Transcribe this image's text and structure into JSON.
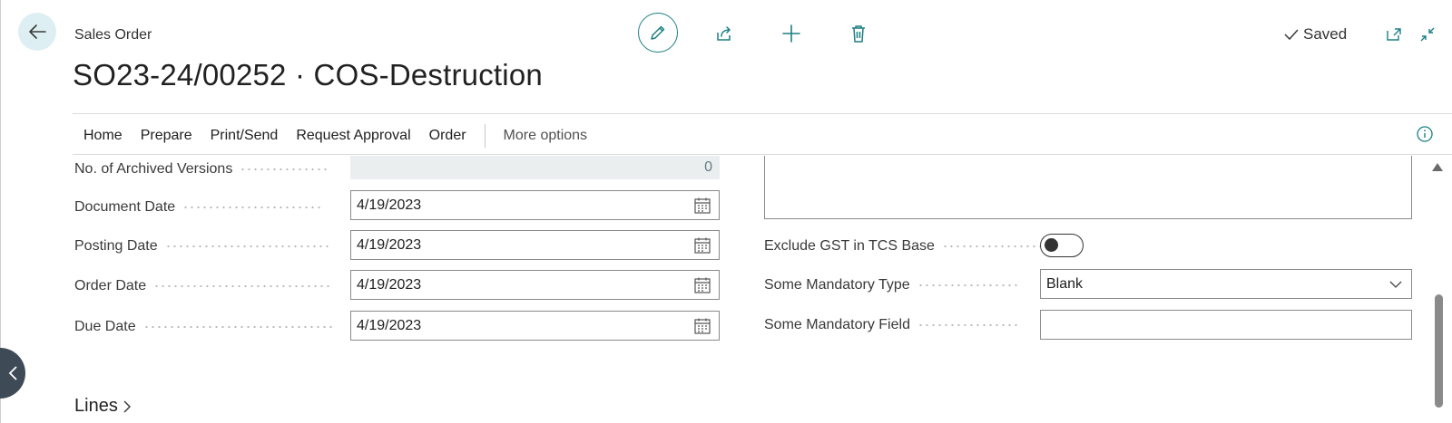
{
  "header": {
    "caption": "Sales Order",
    "title": "SO23-24/00252 · COS-Destruction",
    "saved_label": "Saved"
  },
  "menu": {
    "items": [
      "Home",
      "Prepare",
      "Print/Send",
      "Request Approval",
      "Order"
    ],
    "more": "More options"
  },
  "left_fields": [
    {
      "label": "No. of Archived Versions",
      "value": "0"
    },
    {
      "label": "Document Date",
      "value": "4/19/2023"
    },
    {
      "label": "Posting Date",
      "value": "4/19/2023"
    },
    {
      "label": "Order Date",
      "value": "4/19/2023"
    },
    {
      "label": "Due Date",
      "value": "4/19/2023"
    }
  ],
  "right_fields": {
    "exclude_gst_label": "Exclude GST in TCS Base",
    "exclude_gst_value": false,
    "mandatory_type_label": "Some Mandatory Type",
    "mandatory_type_value": "Blank",
    "mandatory_field_label": "Some Mandatory Field",
    "mandatory_field_value": ""
  },
  "sections": {
    "lines": "Lines"
  },
  "colors": {
    "accent": "#1b7f84",
    "back_bg": "#ddeff3",
    "readonly_bg": "#ebeeef"
  },
  "icons": [
    "back-arrow-icon",
    "pencil-icon",
    "share-icon",
    "plus-icon",
    "trash-icon",
    "check-icon",
    "open-new-window-icon",
    "collapse-icon",
    "info-icon",
    "calendar-icon",
    "chevron-down-icon",
    "chevron-right-icon",
    "chevron-left-icon"
  ]
}
